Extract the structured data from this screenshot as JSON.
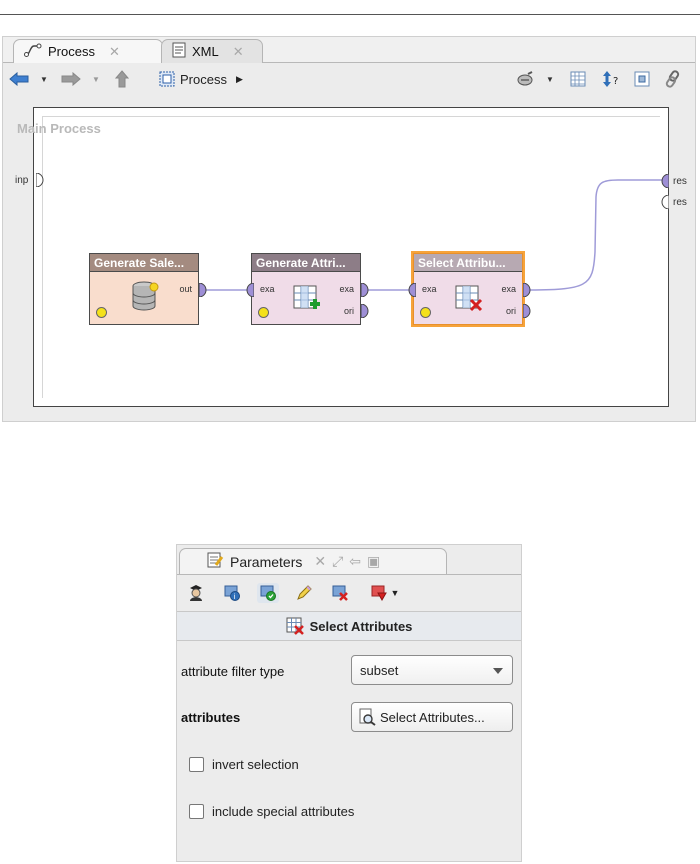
{
  "editor": {
    "tabs": [
      {
        "label": "Process",
        "icon": "process-icon",
        "close": "✕"
      },
      {
        "label": "XML",
        "icon": "xml-icon",
        "close": "✕"
      }
    ],
    "toolbar": {
      "back_icon": "arrow-left-icon",
      "forward_icon": "arrow-right-icon",
      "up_icon": "arrow-up-icon",
      "breadcrumb_label": "Process",
      "breadcrumb_arrow": "▶"
    },
    "canvas": {
      "title": "Main Process",
      "left_port": "inp",
      "right_ports": [
        "res",
        "res"
      ]
    },
    "operators": [
      {
        "title": "Generate Sale...",
        "in": "",
        "outs": [
          "out"
        ],
        "icon": "database-icon",
        "color": "#f9ddcd",
        "title_color": "#a48b80"
      },
      {
        "title": "Generate Attri...",
        "in": "exa",
        "outs": [
          "exa",
          "ori"
        ],
        "icon": "table-add-icon",
        "color": "#f0dce8",
        "title_color": "#8d7d87"
      },
      {
        "title": "Select Attribu...",
        "in": "exa",
        "outs": [
          "exa",
          "ori"
        ],
        "icon": "table-remove-icon",
        "color": "#f0dce8",
        "title_color": "#b7a9b2"
      }
    ]
  },
  "parameters": {
    "tab_label": "Parameters",
    "operator_name": "Select Attributes",
    "rows": {
      "filter_type_label": "attribute filter type",
      "filter_type_value": "subset",
      "attributes_label": "attributes",
      "attributes_button": "Select Attributes..."
    },
    "checkboxes": [
      {
        "label": "invert selection",
        "checked": false
      },
      {
        "label": "include special attributes",
        "checked": false
      }
    ]
  }
}
